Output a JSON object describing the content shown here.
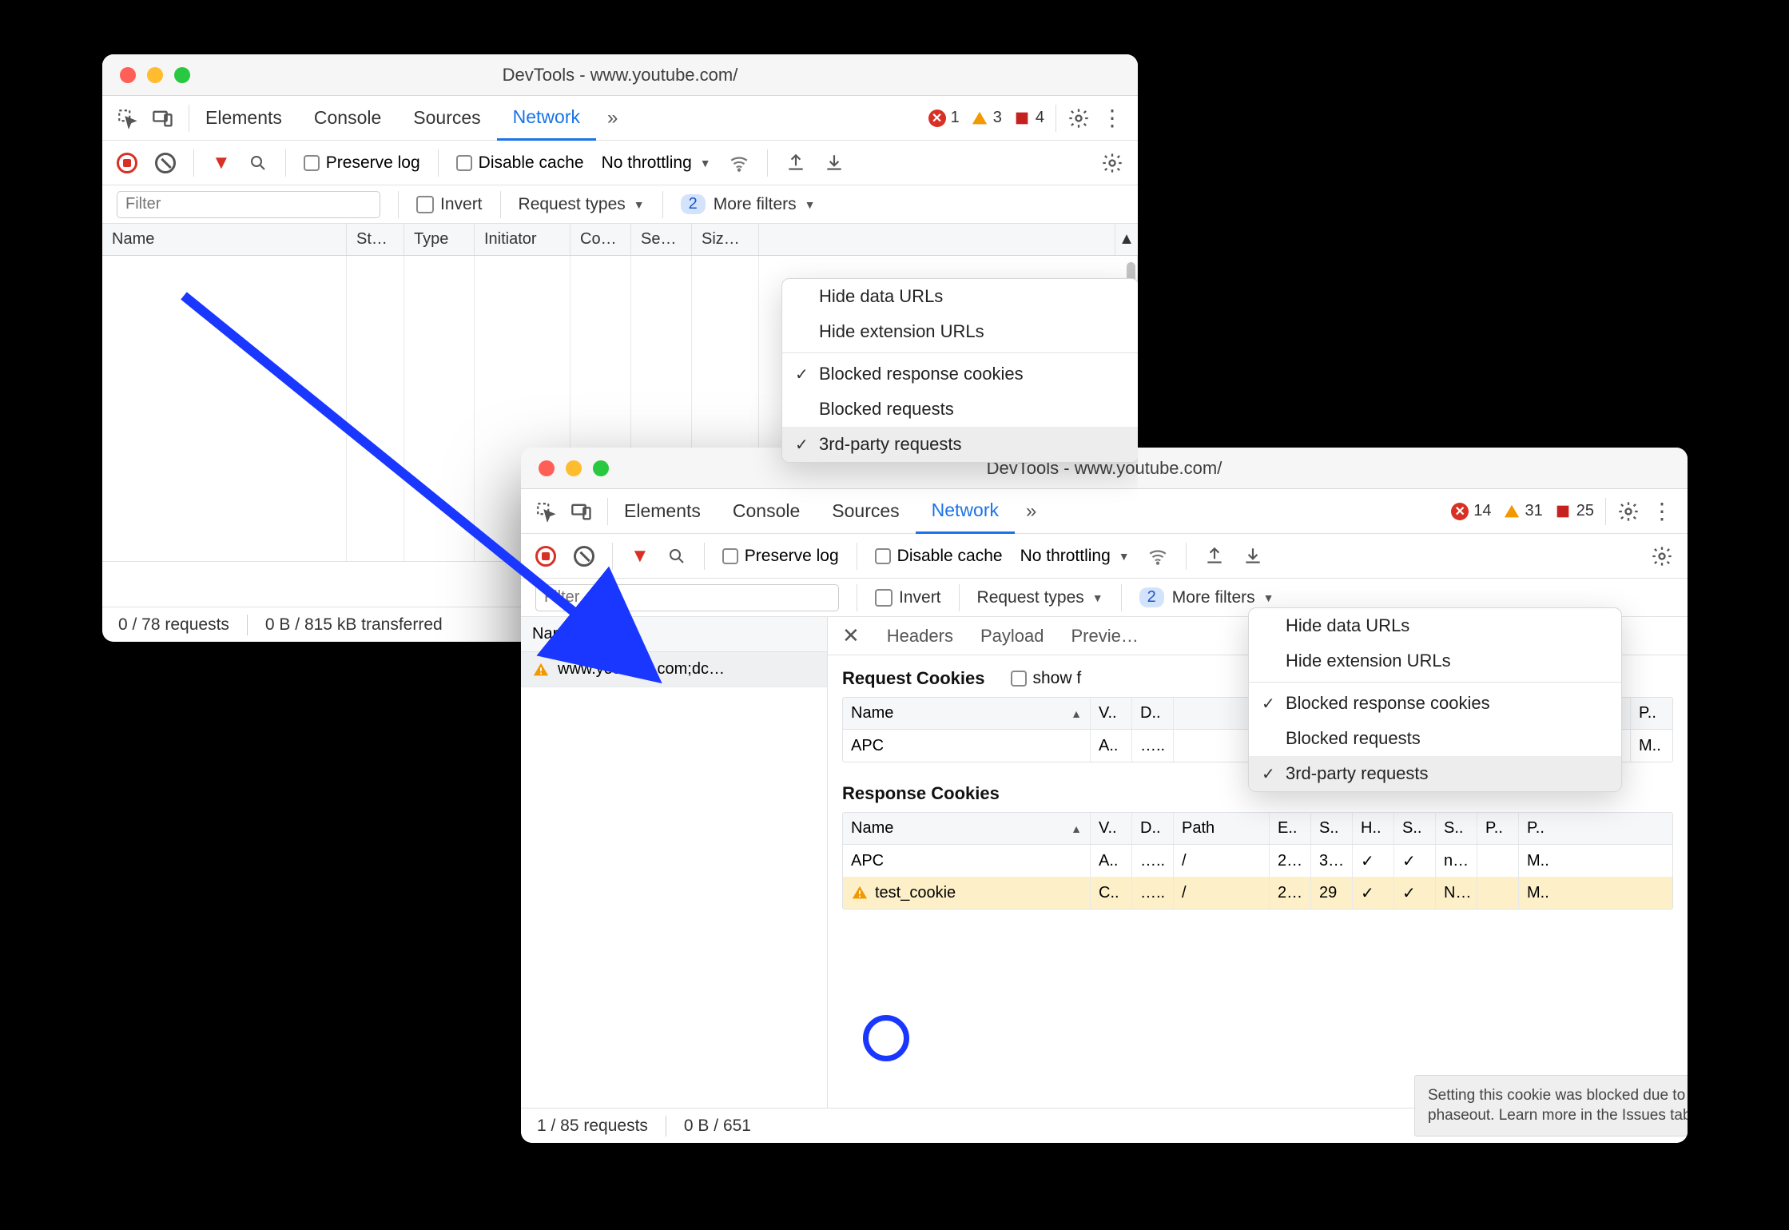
{
  "window1": {
    "title": "DevTools - www.youtube.com/",
    "tabs": [
      "Elements",
      "Console",
      "Sources",
      "Network"
    ],
    "active_tab": "Network",
    "counters": {
      "errors": "1",
      "warnings": "3",
      "info": "4"
    },
    "toolbar": {
      "preserve_log": "Preserve log",
      "disable_cache": "Disable cache",
      "throttling": "No throttling"
    },
    "filterbar": {
      "filter_placeholder": "Filter",
      "invert": "Invert",
      "request_types": "Request types",
      "filter_count": "2",
      "more_filters": "More filters"
    },
    "columns": [
      "Name",
      "St…",
      "Type",
      "Initiator",
      "Co…",
      "Se…",
      "Siz…"
    ],
    "menu": {
      "items": [
        {
          "label": "Hide data URLs",
          "checked": false
        },
        {
          "label": "Hide extension URLs",
          "checked": false
        }
      ],
      "items2": [
        {
          "label": "Blocked response cookies",
          "checked": true
        },
        {
          "label": "Blocked requests",
          "checked": false
        },
        {
          "label": "3rd-party requests",
          "checked": true,
          "selected": true
        }
      ]
    },
    "status": {
      "requests": "0 / 78 requests",
      "transferred": "0 B / 815 kB transferred"
    }
  },
  "window2": {
    "title": "DevTools - www.youtube.com/",
    "tabs": [
      "Elements",
      "Console",
      "Sources",
      "Network"
    ],
    "active_tab": "Network",
    "counters": {
      "errors": "14",
      "warnings": "31",
      "info": "25"
    },
    "toolbar": {
      "preserve_log": "Preserve log",
      "disable_cache": "Disable cache",
      "throttling": "No throttling"
    },
    "filterbar": {
      "filter_placeholder": "Filter",
      "invert": "Invert",
      "request_types": "Request types",
      "filter_count": "2",
      "more_filters": "More filters"
    },
    "left": {
      "header": "Name",
      "row": "www.youtube.com;dc…"
    },
    "detail_tabs": [
      "Headers",
      "Payload",
      "Previe…"
    ],
    "request_cookies": {
      "title": "Request Cookies",
      "show": "show f",
      "cols": [
        "Name",
        "V..",
        "D..",
        "",
        "",
        "",
        "",
        "",
        "P.."
      ],
      "rows": [
        [
          "APC",
          "A..",
          "…..",
          "",
          "",
          "",
          "",
          "",
          "M.."
        ]
      ]
    },
    "response_cookies": {
      "title": "Response Cookies",
      "cols": [
        "Name",
        "V..",
        "D..",
        "Path",
        "E..",
        "S..",
        "H..",
        "S..",
        "S..",
        "P..",
        "P.."
      ],
      "rows": [
        [
          "APC",
          "A..",
          "…..",
          "/",
          "2…",
          "3…",
          "✓",
          "✓",
          "n…",
          "",
          "M.."
        ],
        [
          "test_cookie",
          "C..",
          "…..",
          "/",
          "2…",
          "29",
          "✓",
          "✓",
          "N…",
          "",
          "M.."
        ]
      ],
      "warn_row": 1
    },
    "menu": {
      "items": [
        {
          "label": "Hide data URLs",
          "checked": false
        },
        {
          "label": "Hide extension URLs",
          "checked": false
        }
      ],
      "items2": [
        {
          "label": "Blocked response cookies",
          "checked": true
        },
        {
          "label": "Blocked requests",
          "checked": false
        },
        {
          "label": "3rd-party requests",
          "checked": true,
          "selected": true
        }
      ]
    },
    "status": {
      "requests": "1 / 85 requests",
      "transferred": "0 B / 651"
    },
    "tooltip": "Setting this cookie was blocked due to third-party cookie phaseout. Learn more in the Issues tab."
  }
}
